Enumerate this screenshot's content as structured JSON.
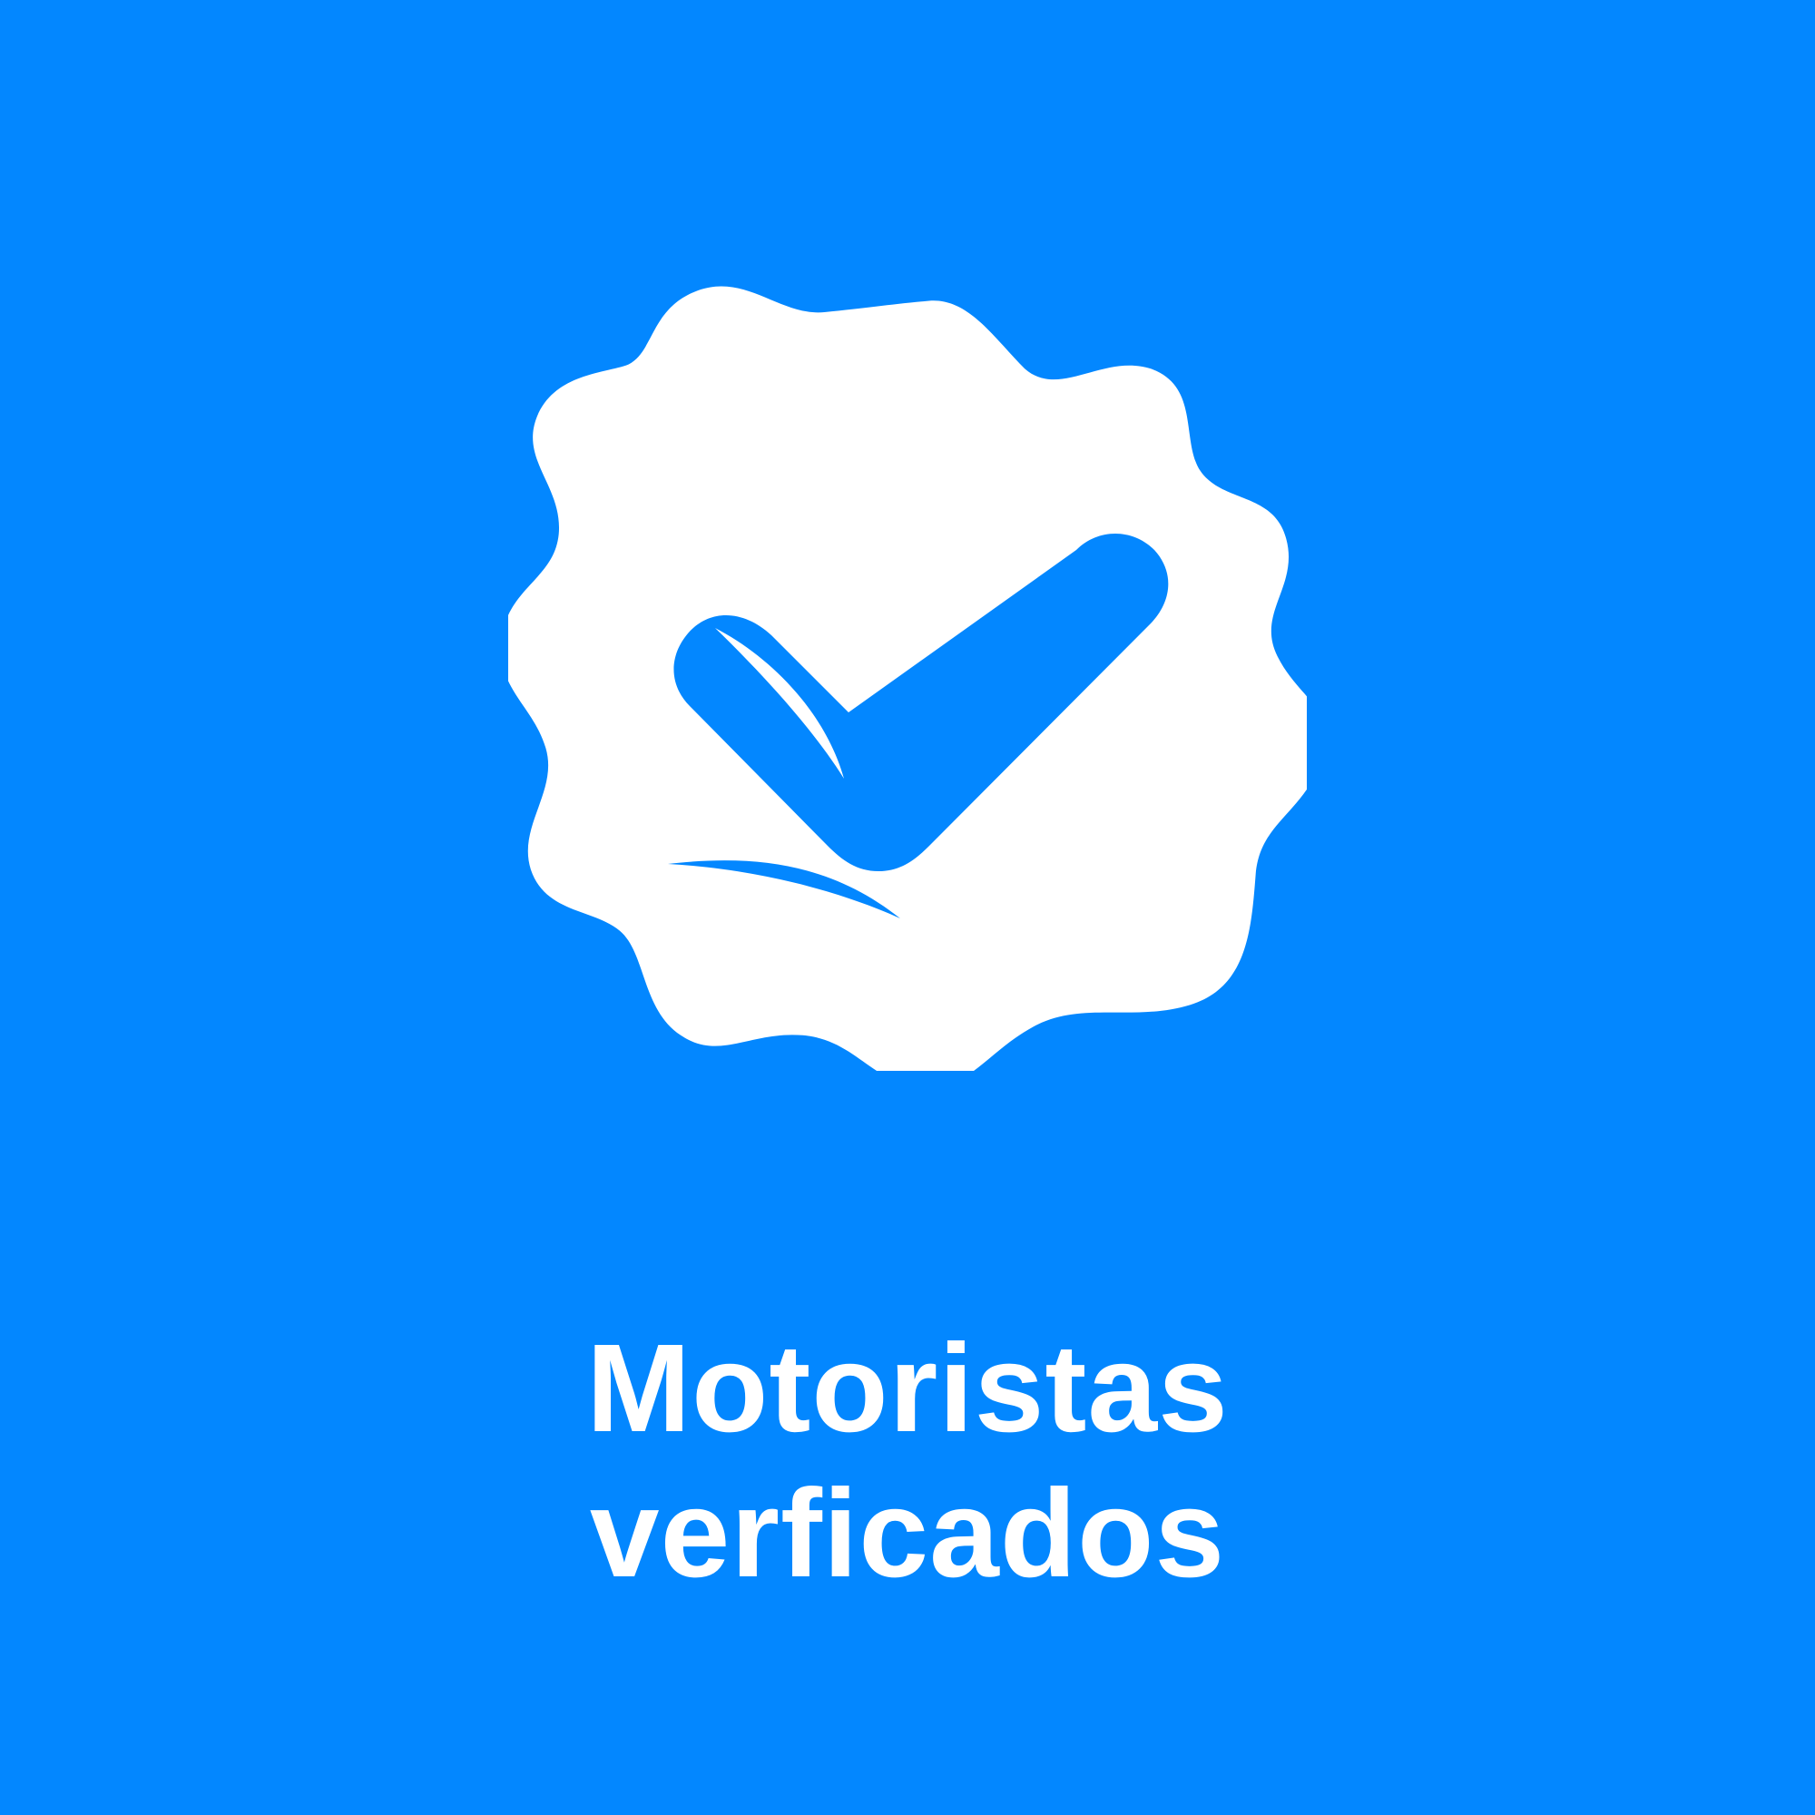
{
  "colors": {
    "background": "#0387FF",
    "foreground": "#FFFFFF"
  },
  "badge": {
    "icon": "verified-check-badge-icon"
  },
  "caption": {
    "line1": "Motoristas",
    "line2": "verficados"
  }
}
